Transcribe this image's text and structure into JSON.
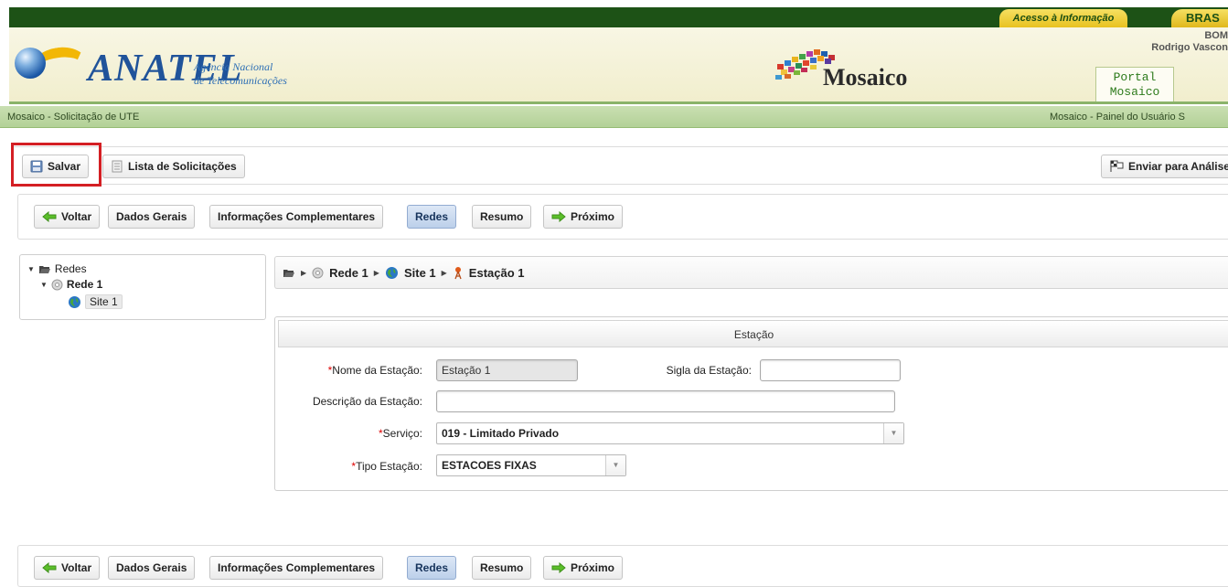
{
  "gov_bar": {
    "acesso": "Acesso à Informação",
    "brasil": "BRAS"
  },
  "header": {
    "logo_text": "ANATEL",
    "agency_line1": "Agência Nacional",
    "agency_line2": "de Telecomunicações",
    "app_name": "Mosaico",
    "greeting": "BOM",
    "user_name": "Rodrigo Vascon",
    "portal_line1": "Portal",
    "portal_line2": "Mosaico"
  },
  "strip": {
    "left": "Mosaico - Solicitação de UTE",
    "right": "Mosaico - Painel do Usuário   S"
  },
  "toolbar": {
    "save": "Salvar",
    "list": "Lista de Solicitações",
    "send": "Enviar para Análise"
  },
  "nav": {
    "back": "Voltar",
    "general": "Dados Gerais",
    "complementary": "Informações Complementares",
    "networks": "Redes",
    "summary": "Resumo",
    "next": "Próximo",
    "active": "Redes"
  },
  "tree": {
    "root": "Redes",
    "network": "Rede 1",
    "site": "Site 1"
  },
  "path": {
    "network": "Rede 1",
    "site": "Site 1",
    "station": "Estação 1"
  },
  "form": {
    "title": "Estação",
    "station_name_label": "Nome da Estação:",
    "station_name_value": "Estação 1",
    "acronym_label": "Sigla da Estação:",
    "acronym_value": "",
    "description_label": "Descrição da Estação:",
    "description_value": "",
    "service_label": "Serviço:",
    "service_value": "019 - Limitado Privado",
    "type_label": "Tipo Estação:",
    "type_value": "ESTACOES FIXAS",
    "required_mark": "*"
  },
  "colors": {
    "gov_green": "#1d5216",
    "highlight_red": "#d41f24",
    "active_tab": "#bcd0ea",
    "anatel_blue": "#20539a"
  }
}
